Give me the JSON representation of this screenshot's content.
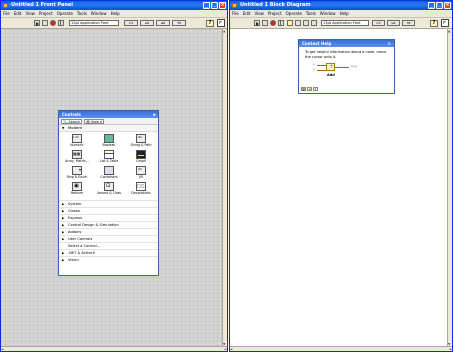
{
  "front_panel": {
    "title": "Untitled 1 Front Panel",
    "menu": [
      "File",
      "Edit",
      "View",
      "Project",
      "Operate",
      "Tools",
      "Window",
      "Help"
    ],
    "font_select": "13pt Application Font"
  },
  "block_diagram": {
    "title": "Untitled 1 Block Diagram",
    "menu": [
      "File",
      "Edit",
      "View",
      "Project",
      "Operate",
      "Tools",
      "Window",
      "Help"
    ],
    "font_select": "13pt Application Font"
  },
  "controls_palette": {
    "title": "Controls",
    "search_label": "Search",
    "view_label": "View",
    "modern_header": "Modern",
    "modern_items": [
      {
        "label": "Numeric",
        "icon": "numeric-icon"
      },
      {
        "label": "Boolean",
        "icon": "boolean-icon"
      },
      {
        "label": "String & Path",
        "icon": "string-path-icon"
      },
      {
        "label": "Array, Matrix...",
        "icon": "array-matrix-icon"
      },
      {
        "label": "List & Table",
        "icon": "list-table-icon"
      },
      {
        "label": "Graph",
        "icon": "graph-icon"
      },
      {
        "label": "Ring & Enum",
        "icon": "ring-enum-icon"
      },
      {
        "label": "Containers",
        "icon": "containers-icon"
      },
      {
        "label": "I/O",
        "icon": "io-icon"
      },
      {
        "label": "Refnum",
        "icon": "refnum-icon"
      },
      {
        "label": "Variant & Class",
        "icon": "variant-class-icon"
      },
      {
        "label": "Decorations",
        "icon": "decorations-icon"
      }
    ],
    "categories": [
      {
        "label": "System",
        "expandable": true
      },
      {
        "label": "Classic",
        "expandable": true
      },
      {
        "label": "Express",
        "expandable": true
      },
      {
        "label": "Control Design & Simulation",
        "expandable": true
      },
      {
        "label": "Addons",
        "expandable": true
      },
      {
        "label": "User Controls",
        "expandable": true
      },
      {
        "label": "Select a Control...",
        "expandable": false
      },
      {
        "label": ".NET & ActiveX",
        "expandable": true
      },
      {
        "label": "Vision",
        "expandable": true
      }
    ]
  },
  "context_help": {
    "title": "Context Help",
    "text": "To get helpful information about a node, move the cursor onto it.",
    "input_x": "x",
    "input_y": "y",
    "output": "x+y",
    "caption": "Add"
  },
  "colors": {
    "titlebar": "#0a5fe0",
    "panel_grid": "#d6d6d6",
    "diagram_bg": "#ffffff",
    "chrome": "#ece9d8"
  }
}
